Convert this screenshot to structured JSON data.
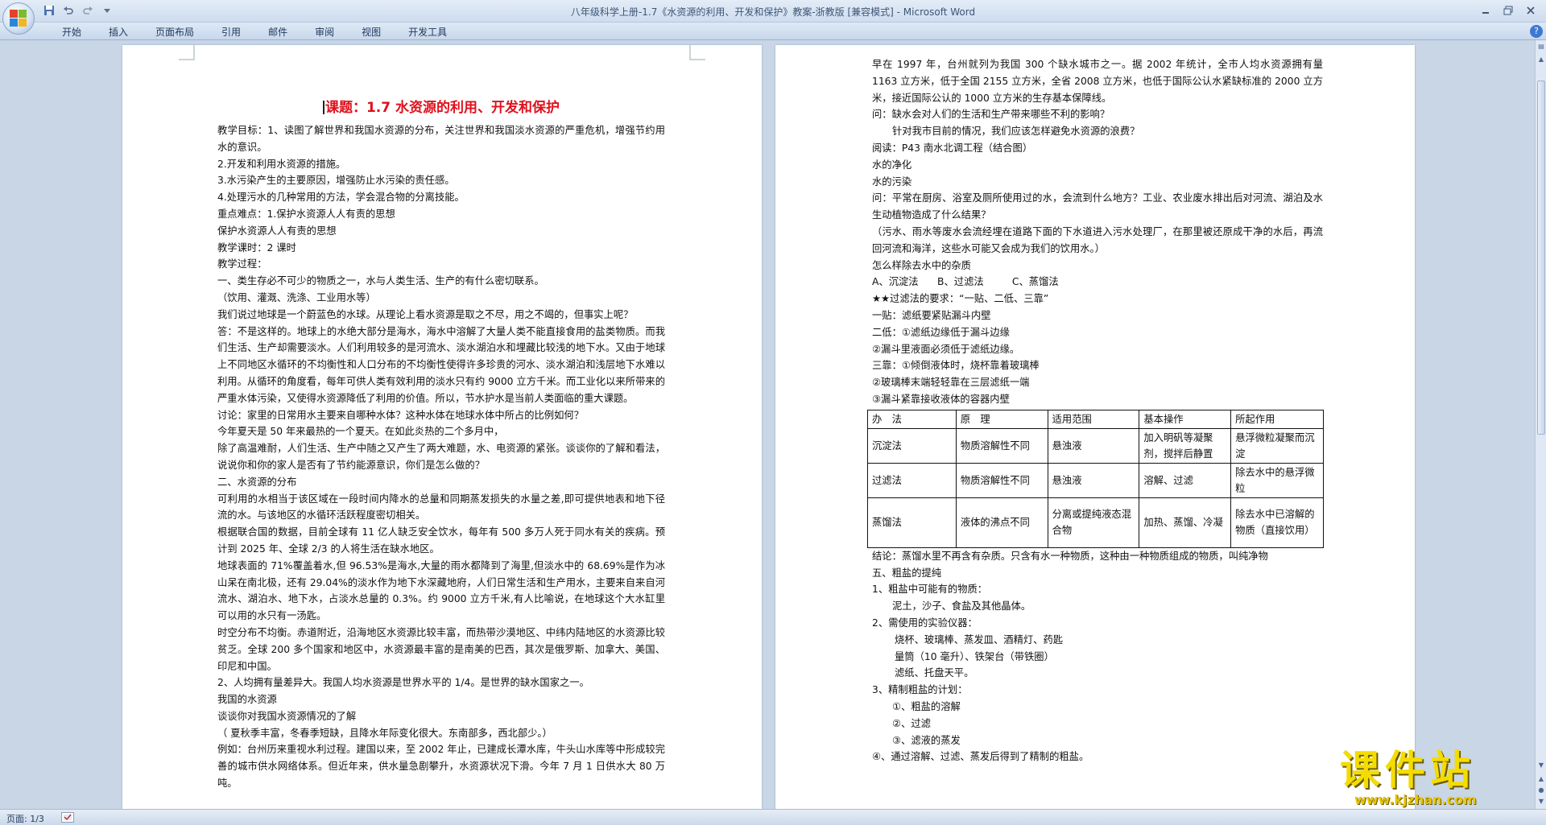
{
  "window": {
    "title": "八年级科学上册-1.7《水资源的利用、开发和保护》教案-浙教版 [兼容模式] - Microsoft Word"
  },
  "ribbon": {
    "tabs": [
      "开始",
      "插入",
      "页面布局",
      "引用",
      "邮件",
      "审阅",
      "视图",
      "开发工具"
    ]
  },
  "page1": {
    "title": "课题：1.7 水资源的利用、开发和保护",
    "lines": [
      "教学目标：1、读图了解世界和我国水资源的分布，关注世界和我国淡水资源的严重危机，增强节约用水的意识。",
      "2.开发和利用水资源的措施。",
      "3.水污染产生的主要原因，增强防止水污染的责任感。",
      "4.处理污水的几种常用的方法，学会混合物的分离技能。",
      "重点难点：1.保护水资源人人有责的思想",
      "保护水资源人人有责的思想",
      "教学课时：2 课时",
      "教学过程：",
      "一、类生存必不可少的物质之一，水与人类生活、生产的有什么密切联系。",
      "（饮用、灌溉、洗涤、工业用水等）",
      "我们说过地球是一个蔚蓝色的水球。从理论上看水资源是取之不尽，用之不竭的，但事实上呢？",
      "答：不是这样的。地球上的水绝大部分是海水，海水中溶解了大量人类不能直接食用的盐类物质。而我们生活、生产却需要淡水。人们利用较多的是河流水、淡水湖泊水和埋藏比较浅的地下水。又由于地球上不同地区水循环的不均衡性和人口分布的不均衡性使得许多珍贵的河水、淡水湖泊和浅层地下水难以利用。从循环的角度看，每年可供人类有效利用的淡水只有约 9000 立方千米。而工业化以来所带来的严重水体污染，又使得水资源降低了利用的价值。所以，节水护水是当前人类面临的重大课题。",
      "讨论：家里的日常用水主要来自哪种水体？这种水体在地球水体中所占的比例如何？",
      "今年夏天是 50 年来最热的一个夏天。在如此炎热的二个多月中，",
      "除了高温难耐，人们生活、生产中随之又产生了两大难题，水、电资源的紧张。谈谈你的了解和看法，说说你和你的家人是否有了节约能源意识，你们是怎么做的？",
      "二、水资源的分布",
      "可利用的水相当于该区域在一段时间内降水的总量和同期蒸发损失的水量之差,即可提供地表和地下径流的水。与该地区的水循环活跃程度密切相关。",
      "根据联合国的数据，目前全球有 11 亿人缺乏安全饮水，每年有 500 多万人死于同水有关的疾病。预计到 2025 年、全球 2/3 的人将生活在缺水地区。",
      "地球表面的 71%覆盖着水,但 96.53%是海水,大量的雨水都降到了海里,但淡水中的 68.69%是作为冰山呆在南北极，还有 29.04%的淡水作为地下水深藏地府，人们日常生活和生产用水，主要来自来自河流水、湖泊水、地下水，占淡水总量的 0.3%。约 9000 立方千米,有人比喻说，在地球这个大水缸里可以用的水只有一汤匙。",
      "时空分布不均衡。赤道附近，沿海地区水资源比较丰富，而热带沙漠地区、中纬内陆地区的水资源比较贫乏。全球 200 多个国家和地区中，水资源最丰富的是南美的巴西，其次是俄罗斯、加拿大、美国、印尼和中国。",
      "2、人均拥有量差异大。我国人均水资源是世界水平的 1/4。是世界的缺水国家之一。",
      "我国的水资源",
      "谈谈你对我国水资源情况的了解",
      "（ 夏秋季丰富，冬春季短缺，且降水年际变化很大。东南部多，西北部少。）",
      "例如：台州历来重视水利过程。建国以来，至 2002 年止，已建成长潭水库，牛头山水库等中形成较完善的城市供水网络体系。但近年来，供水量急剧攀升，水资源状况下滑。今年 7 月 1 日供水大 80 万吨。"
    ]
  },
  "page2": {
    "lines_top": [
      "早在 1997 年，台州就列为我国 300 个缺水城市之一。据 2002 年统计，全市人均水资源拥有量 1163 立方米，低于全国 2155 立方米，全省 2008 立方米，也低于国际公认水紧缺标准的 2000 立方米，接近国际公认的 1000 立方米的生存基本保障线。",
      "问：缺水会对人们的生活和生产带来哪些不利的影响？",
      "针对我市目前的情况，我们应该怎样避免水资源的浪费？",
      "阅读：P43 南水北调工程（结合图）",
      "水的净化",
      "水的污染",
      "问：平常在厨房、浴室及厕所使用过的水，会流到什么地方？工业、农业废水排出后对河流、湖泊及水生动植物造成了什么结果？",
      "（污水、雨水等废水会流经埋在道路下面的下水道进入污水处理厂，在那里被还原成干净的水后，再流回河流和海洋，这些水可能又会成为我们的饮用水。）",
      "怎么样除去水中的杂质",
      "A、沉淀法      B、过滤法         C、蒸馏法",
      "★★过滤法的要求：“一贴、二低、三靠”",
      "一贴：滤纸要紧贴漏斗内壁",
      "二低：①滤纸边缘低于漏斗边缘",
      "②漏斗里液面必须低于滤纸边缘。",
      "三靠：①倾倒液体时，烧杯靠着玻璃棒",
      "②玻璃棒末端轻轻靠在三层滤纸一端",
      "③漏斗紧靠接收液体的容器内壁"
    ],
    "table": {
      "headers": [
        "办　法",
        "原　理",
        "适用范围",
        "基本操作",
        "所起作用"
      ],
      "rows": [
        [
          "沉淀法",
          "物质溶解性不同",
          "悬浊液",
          "加入明矾等凝聚剂，搅拌后静置",
          "悬浮微粒凝聚而沉淀"
        ],
        [
          "过滤法",
          "物质溶解性不同",
          "悬浊液",
          "溶解、过滤",
          "除去水中的悬浮微粒"
        ],
        [
          "蒸馏法",
          "液体的沸点不同",
          "分离或提纯液态混合物",
          "加热、蒸馏、冷凝",
          "除去水中已溶解的物质（直接饮用）"
        ]
      ]
    },
    "lines_bottom": [
      "结论：蒸馏水里不再含有杂质。只含有水一种物质，这种由一种物质组成的物质，叫纯净物",
      "五、粗盐的提纯",
      "1、粗盐中可能有的物质：",
      "泥土，沙子、食盐及其他晶体。",
      "2、需使用的实验仪器：",
      "烧杯、玻璃棒、蒸发皿、酒精灯、药匙",
      "量筒（10 毫升）、铁架台（带铁圈）",
      "滤纸、托盘天平。",
      "3、精制粗盐的计划：",
      "①、粗盐的溶解",
      "②、过滤",
      "③、滤液的蒸发",
      "④、通过溶解、过滤、蒸发后得到了精制的粗盐。"
    ]
  },
  "status": {
    "page_count": "页面: 1/3"
  },
  "watermark": {
    "brand": "课件站",
    "url": "www.kjzhan.com"
  }
}
